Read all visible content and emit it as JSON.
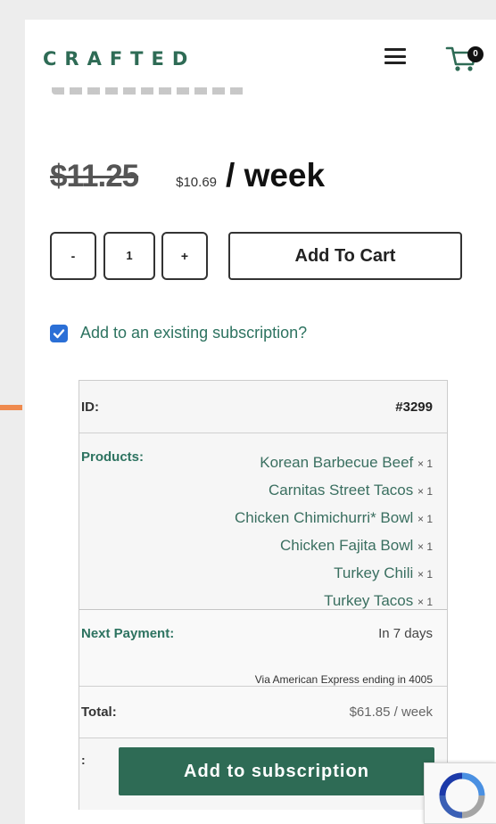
{
  "header": {
    "logo": "CRAFTED",
    "menu_icon": "hamburger-menu-icon",
    "cart_icon": "shopping-cart-icon",
    "cart_count": "0"
  },
  "price": {
    "original": "$11.25",
    "current": "$10.69",
    "period": "/ week"
  },
  "quantity": {
    "decrement": "-",
    "value": "1",
    "increment": "+"
  },
  "add_to_cart_label": "Add To Cart",
  "existing_subscription": {
    "checked": true,
    "label": "Add to an existing subscription?"
  },
  "subscription": {
    "id_label": "ID:",
    "id_value": "#3299",
    "products_label": "Products:",
    "products": [
      {
        "name": "Korean Barbecue Beef",
        "qty": "× 1"
      },
      {
        "name": "Carnitas Street Tacos",
        "qty": "× 1"
      },
      {
        "name": "Chicken Chimichurri* Bowl",
        "qty": "× 1"
      },
      {
        "name": "Chicken Fajita Bowl",
        "qty": "× 1"
      },
      {
        "name": "Turkey Chili",
        "qty": "× 1"
      },
      {
        "name": "Turkey Tacos",
        "qty": "× 1"
      }
    ],
    "next_payment_label": "Next Payment:",
    "next_payment_value": "In 7 days",
    "payment_method": "Via American Express ending in 4005",
    "total_label": "Total:",
    "total_value": "$61.85 / week",
    "action_label": ":",
    "add_button": "Add to subscription"
  },
  "colors": {
    "brand_green": "#2e6b55",
    "accent_orange": "#ef8a4e",
    "checkbox_blue": "#2b6fd6"
  },
  "recaptcha_icon": "recaptcha-icon"
}
